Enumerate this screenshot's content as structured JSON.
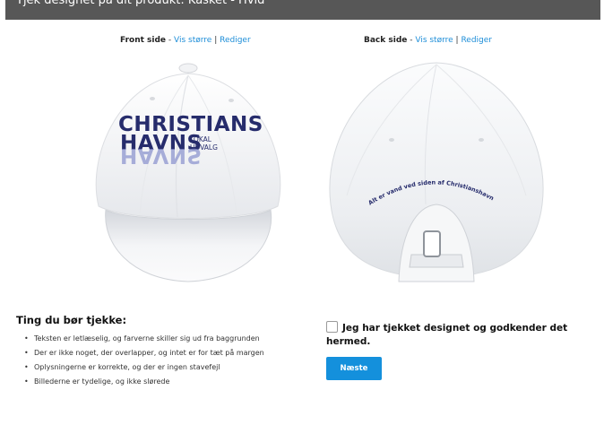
{
  "header": {
    "title": "Tjek designet på dit produkt: Kasket - Hvid"
  },
  "front": {
    "label": "Front side",
    "separator": " - ",
    "view_larger": "Vis større",
    "pipe": " | ",
    "edit": "Rediger",
    "logo_line1": "CHRISTIANS",
    "logo_line2": "HAVNS",
    "logo_small1": "LOKAL",
    "logo_small2": "UDVALG",
    "logo_mirror": "HAVNS"
  },
  "back": {
    "label": "Back side",
    "separator": " - ",
    "view_larger": "Vis større",
    "pipe": " | ",
    "edit": "Rediger",
    "arc_text": "Alt er vand ved siden af Christianshavn"
  },
  "checklist": {
    "title": "Ting du bør tjekke:",
    "bullet": "•",
    "items": [
      "Teksten er letlæselig, og farverne skiller sig ud fra baggrunden",
      "Der er ikke noget, der overlapper, og intet er for tæt på margen",
      "Oplysningerne er korrekte, og der er ingen stavefejl",
      "Billederne er tydelige, og ikke slørede"
    ]
  },
  "approval": {
    "checkbox_label": "Jeg har tjekket designet og godkender det hermed.",
    "checked": false,
    "next_button": "Næste"
  },
  "colors": {
    "link": "#1e8ed8",
    "button": "#1490dc",
    "header_bar": "#575757",
    "logo_navy": "#262c6c"
  }
}
